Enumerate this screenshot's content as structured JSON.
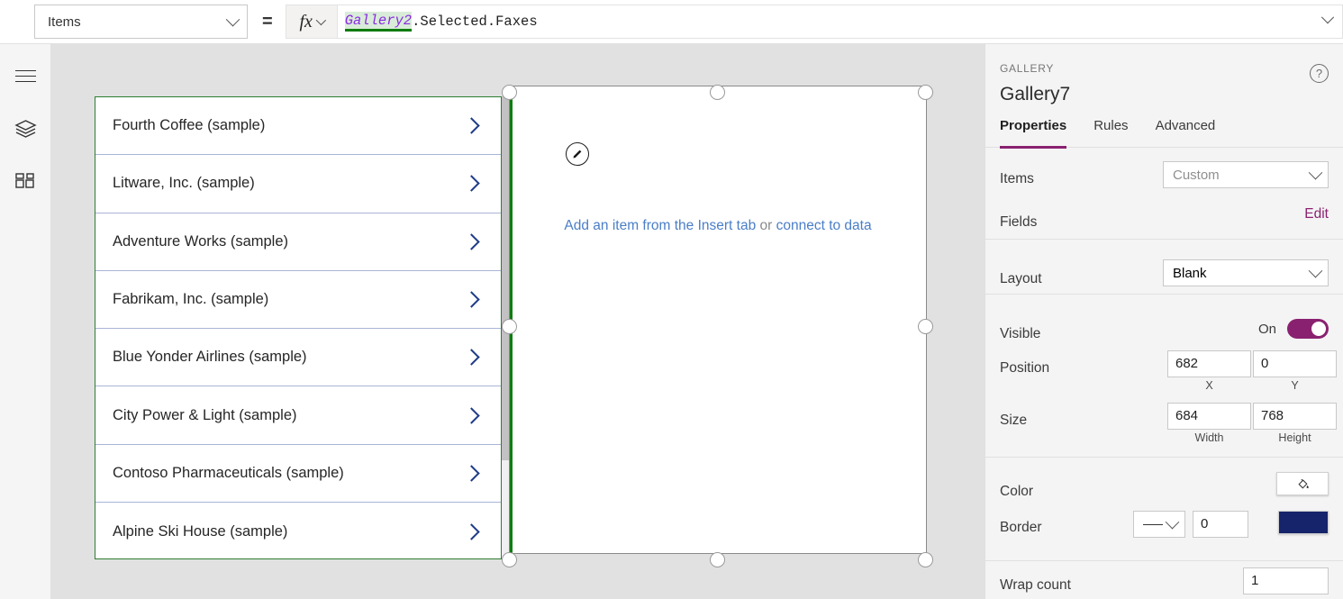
{
  "formula_bar": {
    "property_dropdown": "Items",
    "equals": "=",
    "fx_label": "fx",
    "formula_reference": "Gallery2",
    "formula_rest": ".Selected.Faxes"
  },
  "left_rail": {
    "items": [
      {
        "name": "menu-icon",
        "label": "Menu"
      },
      {
        "name": "tree-view-icon",
        "label": "Tree view"
      },
      {
        "name": "insert-icon",
        "label": "Insert"
      }
    ]
  },
  "canvas": {
    "gallery_left": {
      "items": [
        "Fourth Coffee (sample)",
        "Litware, Inc. (sample)",
        "Adventure Works (sample)",
        "Fabrikam, Inc. (sample)",
        "Blue Yonder Airlines (sample)",
        "City Power & Light (sample)",
        "Contoso Pharmaceuticals (sample)",
        "Alpine Ski House (sample)"
      ]
    },
    "gallery_right": {
      "empty_hint_prefix": "Add an item from the Insert tab",
      "empty_hint_middle": " or ",
      "empty_hint_link": "connect to data"
    }
  },
  "right_panel": {
    "kicker": "GALLERY",
    "title": "Gallery7",
    "help": "?",
    "tabs": [
      {
        "label": "Properties",
        "active": true
      },
      {
        "label": "Rules",
        "active": false
      },
      {
        "label": "Advanced",
        "active": false
      }
    ],
    "rows": {
      "items_label": "Items",
      "items_value": "Custom",
      "fields_label": "Fields",
      "fields_action": "Edit",
      "layout_label": "Layout",
      "layout_value": "Blank",
      "visible_label": "Visible",
      "visible_state": "On",
      "position_label": "Position",
      "position_x": "682",
      "position_y": "0",
      "position_x_sub": "X",
      "position_y_sub": "Y",
      "size_label": "Size",
      "size_width": "684",
      "size_height": "768",
      "size_width_sub": "Width",
      "size_height_sub": "Height",
      "color_label": "Color",
      "border_label": "Border",
      "border_width": "0",
      "border_color": "#16246b",
      "wrap_count_label": "Wrap count",
      "wrap_count_value": "1"
    }
  },
  "colors": {
    "accent": "#8a2170",
    "selection_green": "#107c10",
    "link_blue": "#4a7ec7",
    "canvas_bg": "#e1e1e1"
  }
}
